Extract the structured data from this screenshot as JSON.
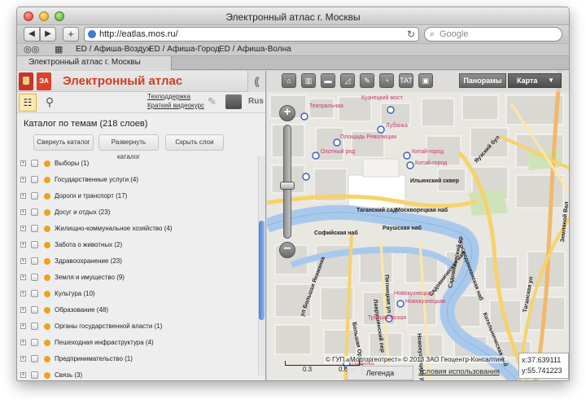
{
  "window": {
    "title": "Электронный атлас г. Москвы"
  },
  "browser": {
    "url": "http://eatlas.mos.ru/",
    "search_placeholder": "Google",
    "bookmarks": [
      "ED / Афиша-Воздух",
      "ED / Афиша-Город",
      "ED / Афиша-Волна"
    ],
    "tab_title": "Электронный атлас г. Москвы"
  },
  "site": {
    "title": "Электронный атлас",
    "links": {
      "support": "Техподдержка",
      "video": "Краткий видеокурс"
    },
    "lang": "Rus",
    "atlas_logo_text": "ЭА"
  },
  "catalog": {
    "title": "Каталог по темам (218 слоев)",
    "buttons": {
      "collapse": "Свернуть каталог",
      "expand": "Развернуть каталог",
      "hide": "Скрыть слои"
    },
    "layers": [
      "Выборы (1)",
      "Государственные услуги (4)",
      "Дороги и транспорт (17)",
      "Досуг и отдых (23)",
      "Жилищно-коммунальное хозяйство (4)",
      "Забота о животных (2)",
      "Здравоохранение (23)",
      "Земля и имущество (9)",
      "Культура (10)",
      "Образование (48)",
      "Органы государственной власти (1)",
      "Пешеходная инфраструктура (4)",
      "Предпринимательство (1)",
      "Связь (3)"
    ]
  },
  "map": {
    "tools": [
      "home-icon",
      "building-icon",
      "ruler-icon",
      "area-icon",
      "pen-icon",
      "clock-icon",
      "tat-icon",
      "layers-icon"
    ],
    "tat_label": "TAT",
    "panoramas": "Панорамы",
    "map_type": "Карта",
    "copyright": "© ГУП «Мосгоргеотрест» © 2013 ЗАО Геоцентр-Консалтинг",
    "scale_labels": [
      "0.3",
      "0.6км"
    ],
    "legend": "Легенда",
    "terms": "Условия использования",
    "coords": {
      "x": "x:37.639111",
      "y": "y:55.741223"
    },
    "streets": [
      "Москворецкая наб",
      "Раушская наб",
      "Софийская наб",
      "Садовническая наб",
      "Космодамианская наб",
      "Яузский бул",
      "Земляной Вал",
      "Большая Ордынка",
      "Пятницкая ул",
      "Новокузнецкая ул",
      "Садовнический пр",
      "Котельническая наб",
      "Таганская ул",
      "Ильинский сквер",
      "Лаврушинский пер",
      "Таганский сад",
      "ул Большая Якиманка"
    ],
    "pois": [
      "Театральная",
      "Площадь Революции",
      "Лубянка",
      "Китай-город",
      "Новокузнецкая",
      "Третьяковская",
      "Полянка",
      "Новокузнецкая",
      "Кузнецкий мост",
      "Охотный ряд",
      "Китай-город"
    ]
  },
  "colors": {
    "accent": "#d23d1f",
    "river": "#a9c9ec",
    "road_major": "#f5d36b",
    "road_arterial": "#f2b86a"
  }
}
